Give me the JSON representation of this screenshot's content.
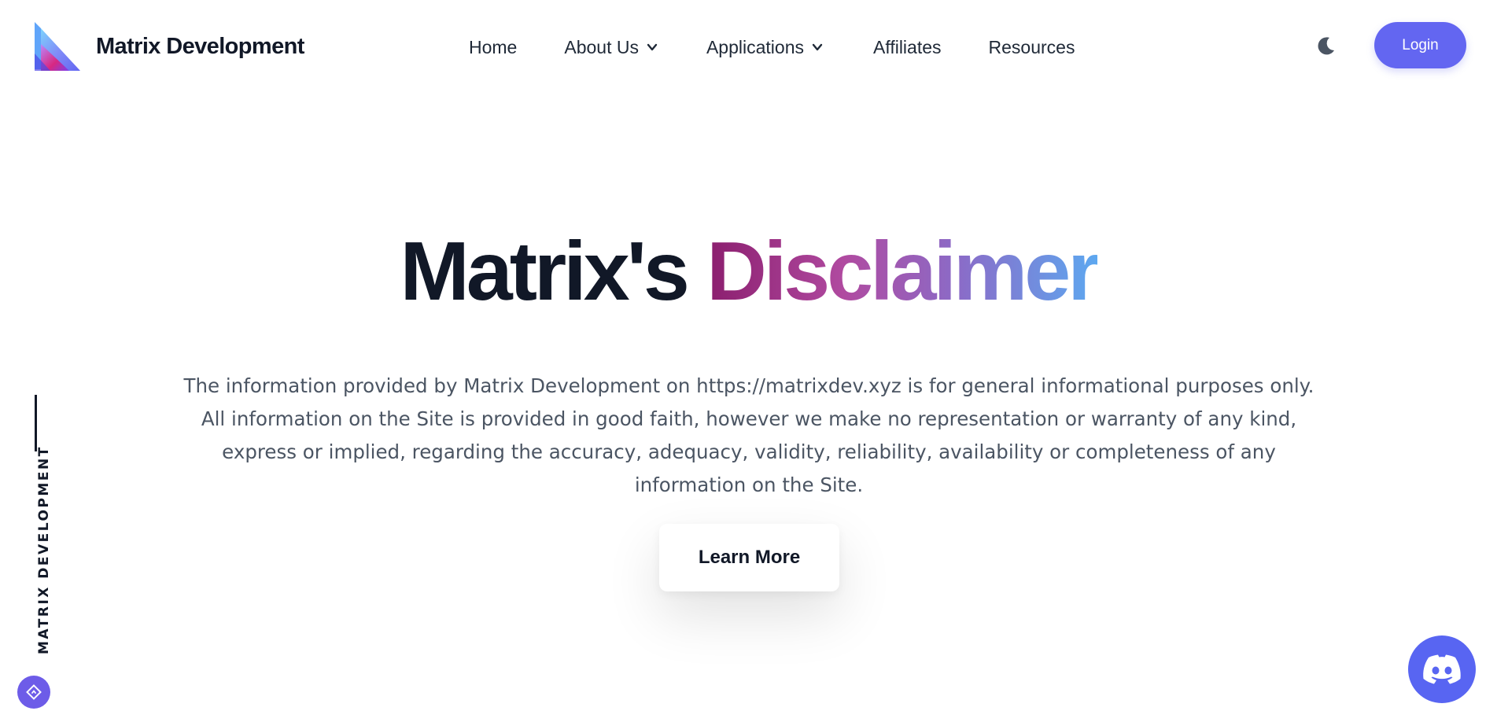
{
  "header": {
    "brand_name": "Matrix Development",
    "nav": [
      {
        "label": "Home"
      },
      {
        "label": "About Us"
      },
      {
        "label": "Applications"
      },
      {
        "label": "Affiliates"
      },
      {
        "label": "Resources"
      }
    ],
    "login_label": "Login",
    "theme_icon": "moon-icon"
  },
  "hero": {
    "title_plain": "Matrix's ",
    "title_highlight": "Disclaimer",
    "text": "The information provided by Matrix Development on https://matrixdev.xyz is for general informational purposes only. All information on the Site is provided in good faith, however we make no representation or warranty of any kind, express or implied, regarding the accuracy, adequacy, validity, reliability, availability or completeness of any information on the Site.",
    "button_label": "Learn More"
  },
  "side": {
    "label": "MATRIX DEVELOPMENT"
  },
  "colors": {
    "accent": "#6366f1",
    "discord": "#5865f2",
    "title_gradient_start": "#8b1e6e",
    "title_gradient_end": "#5da8f0"
  },
  "icons": {
    "scroll": "diamond-arrow-icon",
    "discord": "discord-icon"
  }
}
